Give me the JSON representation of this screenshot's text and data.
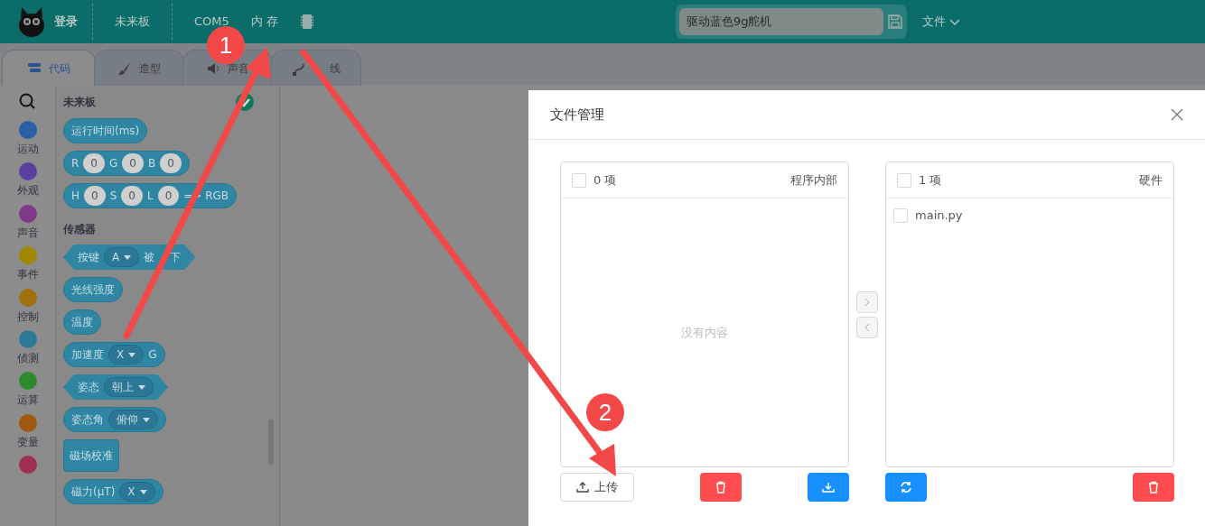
{
  "topbar": {
    "login": "登录",
    "board": "未来板",
    "port": "COM5",
    "memory": "内 存",
    "project_name": "驱动蓝色9g舵机",
    "file_menu": "文件"
  },
  "tabs": [
    {
      "label": "代码",
      "selected": true
    },
    {
      "label": "造型",
      "selected": false
    },
    {
      "label": "声音",
      "selected": false
    },
    {
      "label": "线",
      "selected": false
    }
  ],
  "categories": [
    {
      "label": "运动",
      "color": "#2a5fa8"
    },
    {
      "label": "外观",
      "color": "#5a3fa0"
    },
    {
      "label": "声音",
      "color": "#7e3a86"
    },
    {
      "label": "事件",
      "color": "#a08800"
    },
    {
      "label": "控制",
      "color": "#a0700c"
    },
    {
      "label": "侦测",
      "color": "#2e7a96"
    },
    {
      "label": "运算",
      "color": "#2f8a2f"
    },
    {
      "label": "变量",
      "color": "#a05810"
    },
    {
      "color": "#a03050"
    }
  ],
  "palette": [
    {
      "title": "未来板",
      "checked": true,
      "blocks": [
        {
          "kind": "reporter",
          "parts": [
            {
              "kind": "text",
              "text": "运行时间(ms)"
            }
          ]
        },
        {
          "kind": "reporter",
          "parts": [
            {
              "kind": "text",
              "text": "R"
            },
            {
              "kind": "field",
              "text": "0"
            },
            {
              "kind": "text",
              "text": "G"
            },
            {
              "kind": "field",
              "text": "0"
            },
            {
              "kind": "text",
              "text": "B"
            },
            {
              "kind": "field",
              "text": "0"
            }
          ]
        },
        {
          "kind": "reporter",
          "parts": [
            {
              "kind": "text",
              "text": "H"
            },
            {
              "kind": "field",
              "text": "0"
            },
            {
              "kind": "text",
              "text": "S"
            },
            {
              "kind": "field",
              "text": "0"
            },
            {
              "kind": "text",
              "text": "L"
            },
            {
              "kind": "field",
              "text": "0"
            },
            {
              "kind": "text",
              "text": "=> RGB"
            }
          ]
        }
      ]
    },
    {
      "title": "传感器",
      "blocks": [
        {
          "kind": "boolean",
          "parts": [
            {
              "kind": "text",
              "text": "按键"
            },
            {
              "kind": "dropdown",
              "text": "A"
            },
            {
              "kind": "text",
              "text": "被"
            },
            {
              "kind": "gaptext",
              "text": "下"
            }
          ]
        },
        {
          "kind": "reporter",
          "parts": [
            {
              "kind": "text",
              "text": "光线强度"
            }
          ]
        },
        {
          "kind": "reporter",
          "parts": [
            {
              "kind": "text",
              "text": "温度"
            }
          ]
        },
        {
          "kind": "reporter",
          "parts": [
            {
              "kind": "text",
              "text": "加速度"
            },
            {
              "kind": "dropdown",
              "text": "X"
            },
            {
              "kind": "text",
              "text": "G"
            }
          ]
        },
        {
          "kind": "boolean",
          "parts": [
            {
              "kind": "text",
              "text": "姿态"
            },
            {
              "kind": "dropdown",
              "text": "朝上"
            }
          ]
        },
        {
          "kind": "reporter",
          "parts": [
            {
              "kind": "text",
              "text": "姿态角"
            },
            {
              "kind": "dropdown",
              "text": "俯仰"
            }
          ]
        },
        {
          "kind": "command",
          "parts": [
            {
              "kind": "text",
              "text": "磁场校准"
            }
          ]
        },
        {
          "kind": "reporter",
          "parts": [
            {
              "kind": "text",
              "text": "磁力(μT)"
            },
            {
              "kind": "dropdown",
              "text": "X"
            }
          ]
        }
      ]
    }
  ],
  "dialog": {
    "title": "文件管理",
    "panels": [
      {
        "checked": false,
        "count": "0 项",
        "title": "程序内部",
        "empty_text": "没有内容"
      },
      {
        "checked": false,
        "count": "1 项",
        "title": "硬件",
        "items": [
          {
            "name": "main.py",
            "checked": false
          }
        ]
      }
    ],
    "transfer_buttons": [
      {
        "kind": "right",
        "disabled": true
      },
      {
        "kind": "left",
        "disabled": true
      }
    ],
    "left_actions": [
      {
        "kind": "upload",
        "label": "上传"
      },
      {
        "kind": "delete"
      },
      {
        "kind": "download"
      }
    ],
    "right_actions": [
      {
        "kind": "refresh"
      },
      {
        "kind": "delete"
      }
    ]
  },
  "annotations": [
    {
      "number": "1"
    },
    {
      "number": "2"
    }
  ]
}
